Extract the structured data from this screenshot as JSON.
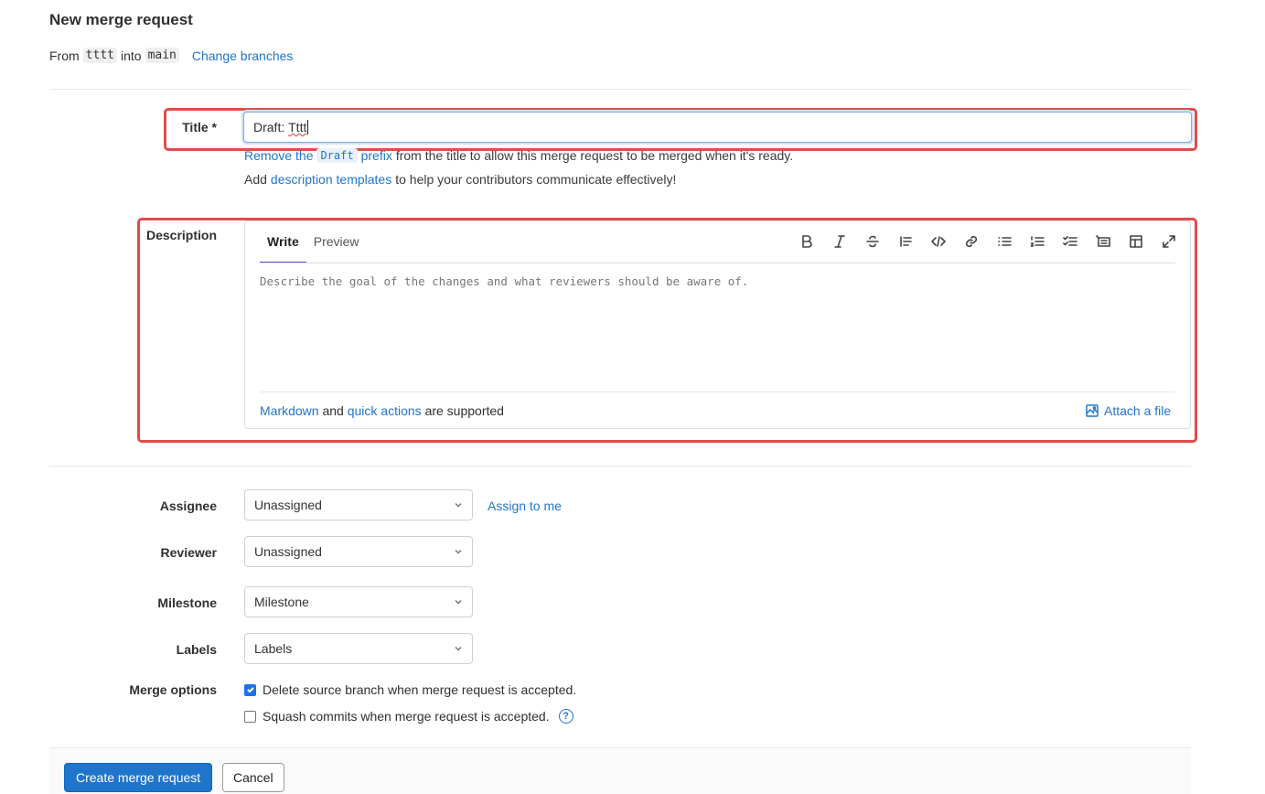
{
  "page": {
    "title": "New merge request"
  },
  "branches": {
    "from_label": "From",
    "source": "tttt",
    "into_label": "into",
    "target": "main",
    "change_link": "Change branches"
  },
  "title_field": {
    "label": "Title *",
    "value_prefix": "Draft: ",
    "value_word": "Tttt",
    "draft_help": {
      "link_a": "Remove the",
      "code": "Draft",
      "link_b": "prefix",
      "rest": "from the title to allow this merge request to be merged when it's ready."
    },
    "templates_help": {
      "before": "Add",
      "link": "description templates",
      "after": "to help your contributors communicate effectively!"
    }
  },
  "description": {
    "label": "Description",
    "tabs": [
      {
        "label": "Write",
        "active": true
      },
      {
        "label": "Preview",
        "active": false
      }
    ],
    "toolbar_icons": [
      "bold-icon",
      "italic-icon",
      "strikethrough-icon",
      "quote-icon",
      "code-icon",
      "link-icon",
      "bulleted-list-icon",
      "numbered-list-icon",
      "task-list-icon",
      "collapsible-section-icon",
      "table-icon",
      "fullscreen-icon"
    ],
    "placeholder": "Describe the goal of the changes and what reviewers should be aware of.",
    "footer": {
      "markdown": "Markdown",
      "and": "and",
      "quick_actions": "quick actions",
      "supported": "are supported"
    },
    "attach": "Attach a file"
  },
  "assignee": {
    "label": "Assignee",
    "value": "Unassigned",
    "assign_link": "Assign to me"
  },
  "reviewer": {
    "label": "Reviewer",
    "value": "Unassigned"
  },
  "milestone": {
    "label": "Milestone",
    "value": "Milestone"
  },
  "labels": {
    "label": "Labels",
    "value": "Labels"
  },
  "merge_options": {
    "label": "Merge options",
    "delete_source": {
      "text": "Delete source branch when merge request is accepted.",
      "checked": true
    },
    "squash": {
      "text": "Squash commits when merge request is accepted.",
      "checked": false
    }
  },
  "actions": {
    "create": "Create merge request",
    "cancel": "Cancel"
  },
  "colors": {
    "link": "#1f75cb",
    "primary": "#1f75cb",
    "highlight": "#e24b4b",
    "active_tab": "#6e49cb",
    "checkbox": "#1a73e8"
  }
}
